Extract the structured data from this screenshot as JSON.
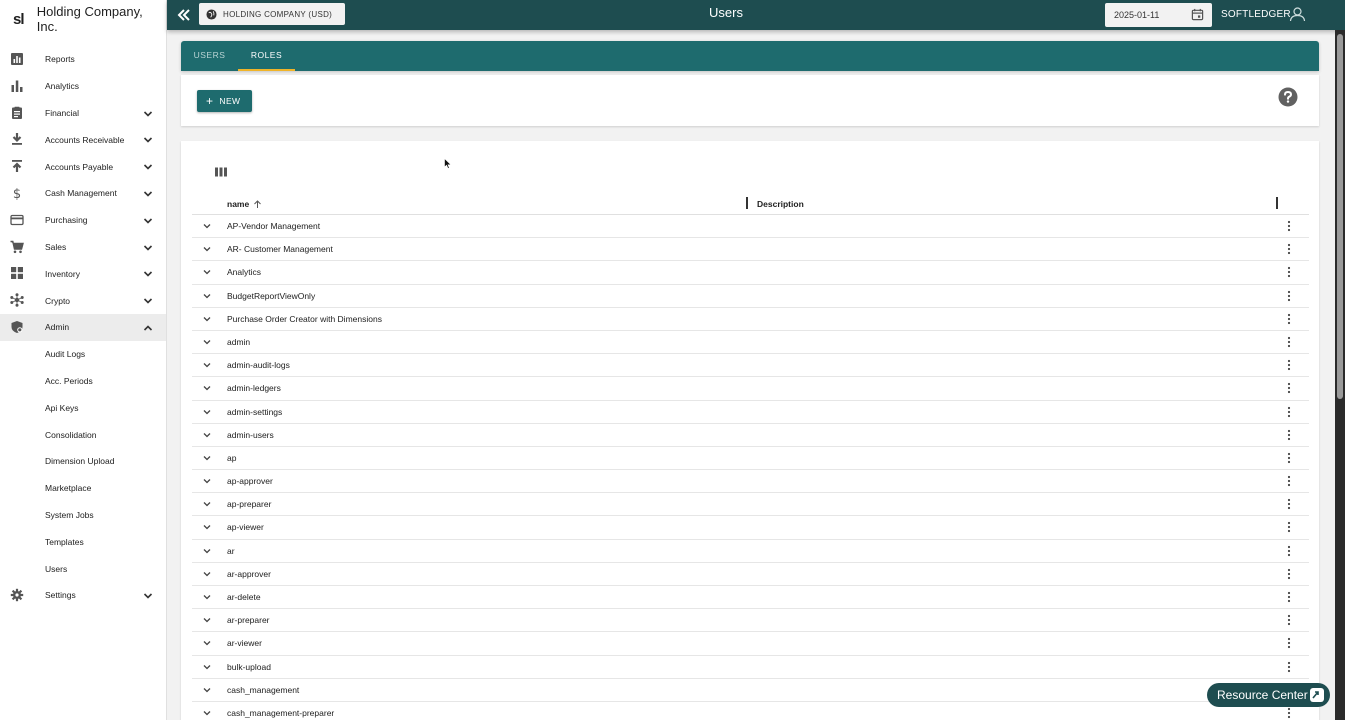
{
  "brand": {
    "logo": "sl",
    "company": "Holding Company, Inc."
  },
  "topbar": {
    "company_selector": "HOLDING COMPANY (USD)",
    "title": "Users",
    "date": "2025-01-11",
    "user": "SOFTLEDGER"
  },
  "sidebar": {
    "items": [
      {
        "label": "Reports",
        "icon": "reports-icon",
        "chevron": false
      },
      {
        "label": "Analytics",
        "icon": "analytics-icon",
        "chevron": false
      },
      {
        "label": "Financial",
        "icon": "financial-icon",
        "chevron": true
      },
      {
        "label": "Accounts Receivable",
        "icon": "download-icon",
        "chevron": true
      },
      {
        "label": "Accounts Payable",
        "icon": "upload-icon",
        "chevron": true
      },
      {
        "label": "Cash Management",
        "icon": "dollar-icon",
        "chevron": true
      },
      {
        "label": "Purchasing",
        "icon": "credit-card-icon",
        "chevron": true
      },
      {
        "label": "Sales",
        "icon": "cart-icon",
        "chevron": true
      },
      {
        "label": "Inventory",
        "icon": "grid-icon",
        "chevron": true
      },
      {
        "label": "Crypto",
        "icon": "crypto-icon",
        "chevron": true
      },
      {
        "label": "Admin",
        "icon": "admin-icon",
        "chevron": true,
        "expanded": true
      }
    ],
    "admin_sub": [
      "Audit Logs",
      "Acc. Periods",
      "Api Keys",
      "Consolidation",
      "Dimension Upload",
      "Marketplace",
      "System Jobs",
      "Templates",
      "Users"
    ],
    "settings": {
      "label": "Settings",
      "icon": "gear-icon"
    }
  },
  "tabs": {
    "users": "USERS",
    "roles": "ROLES",
    "active": "ROLES"
  },
  "toolbar": {
    "new_label": "NEW"
  },
  "table": {
    "columns": {
      "name": "name",
      "description": "Description"
    },
    "rows": [
      "AP-Vendor Management",
      "AR- Customer Management",
      "Analytics",
      "BudgetReportViewOnly",
      "Purchase Order Creator with Dimensions",
      "admin",
      "admin-audit-logs",
      "admin-ledgers",
      "admin-settings",
      "admin-users",
      "ap",
      "ap-approver",
      "ap-preparer",
      "ap-viewer",
      "ar",
      "ar-approver",
      "ar-delete",
      "ar-preparer",
      "ar-viewer",
      "bulk-upload",
      "cash_management",
      "cash_management-preparer"
    ]
  },
  "resource_center": "Resource Center",
  "colors": {
    "topbar": "#1e4d50",
    "tabs": "#1e6b6e",
    "accent": "#f0b429"
  }
}
